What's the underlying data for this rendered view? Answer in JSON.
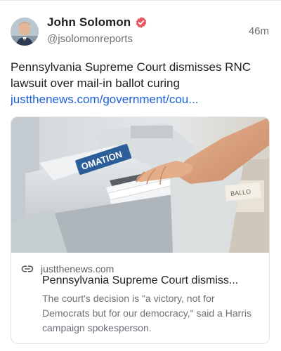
{
  "post": {
    "author_name": "John Solomon",
    "author_handle": "@jsolomonreports",
    "timestamp": "46m",
    "text": "Pennsylvania Supreme Court dismisses RNC lawsuit over mail-in ballot curing",
    "link_display": "justthenews.com/government/cou...",
    "verified_icon": "verified-badge-icon",
    "avatar_icon": "avatar"
  },
  "embed": {
    "domain": "justthenews.com",
    "title": "Pennsylvania Supreme Court dismiss...",
    "description": "The court's decision is \"a victory, not for Democrats but for our democracy,\" said a Harris campaign spokesperson.",
    "image_machine_label": "OMATION",
    "image_tray_label": "BALLO"
  },
  "colors": {
    "link": "#1d5fd8",
    "verified": "#e8575f",
    "muted": "#6e7077"
  }
}
